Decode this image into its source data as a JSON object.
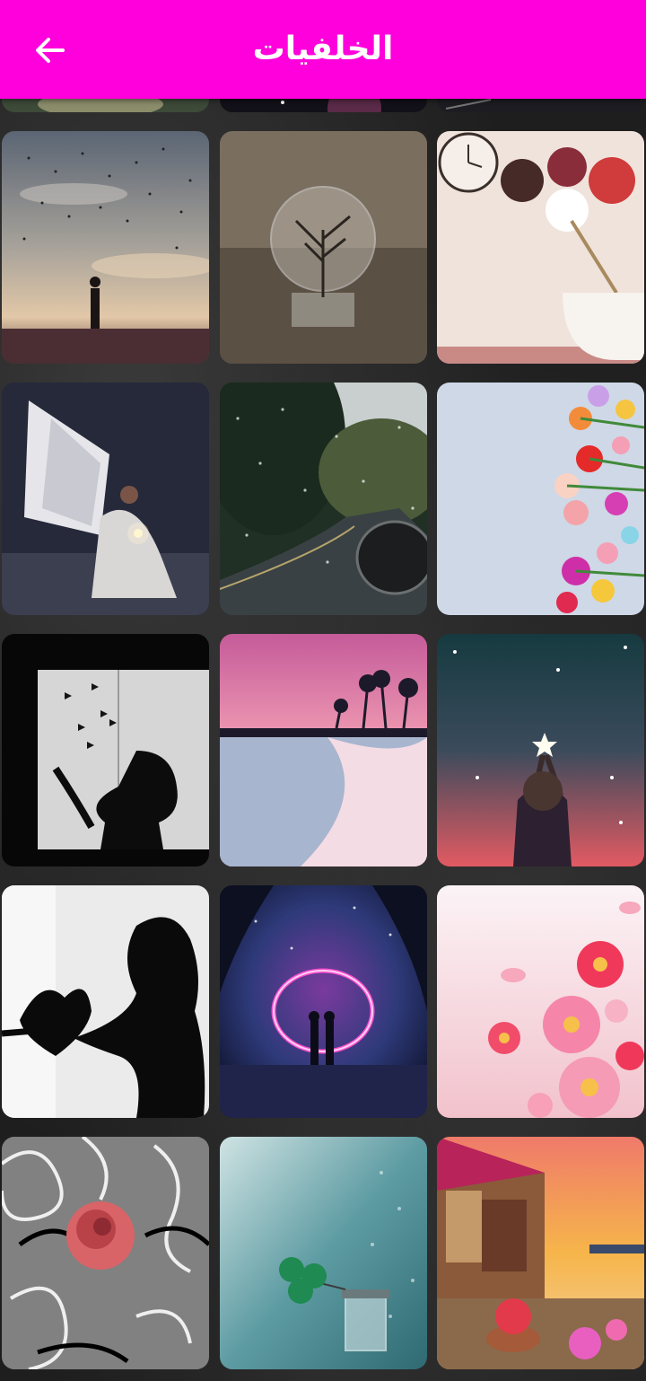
{
  "appbar": {
    "title": "الخلفيات",
    "back_icon": "arrow-back-icon",
    "color": "#ff00dd"
  },
  "wallpapers": [
    {
      "name": "wallpaper-partial-1"
    },
    {
      "name": "wallpaper-partial-2"
    },
    {
      "name": "wallpaper-partial-3"
    },
    {
      "name": "wallpaper-birds-silhouette"
    },
    {
      "name": "wallpaper-tree-lightbulb"
    },
    {
      "name": "wallpaper-clock-flowers"
    },
    {
      "name": "wallpaper-angel-candle"
    },
    {
      "name": "wallpaper-rainy-road"
    },
    {
      "name": "wallpaper-flowers-blue-wall"
    },
    {
      "name": "wallpaper-butterflies-silhouette"
    },
    {
      "name": "wallpaper-pink-beach"
    },
    {
      "name": "wallpaper-girl-star"
    },
    {
      "name": "wallpaper-heart-silhouette"
    },
    {
      "name": "wallpaper-neon-portal-couple"
    },
    {
      "name": "wallpaper-pink-cosmos"
    },
    {
      "name": "wallpaper-rose-fence"
    },
    {
      "name": "wallpaper-clover-jar"
    },
    {
      "name": "wallpaper-sunset-street"
    }
  ]
}
